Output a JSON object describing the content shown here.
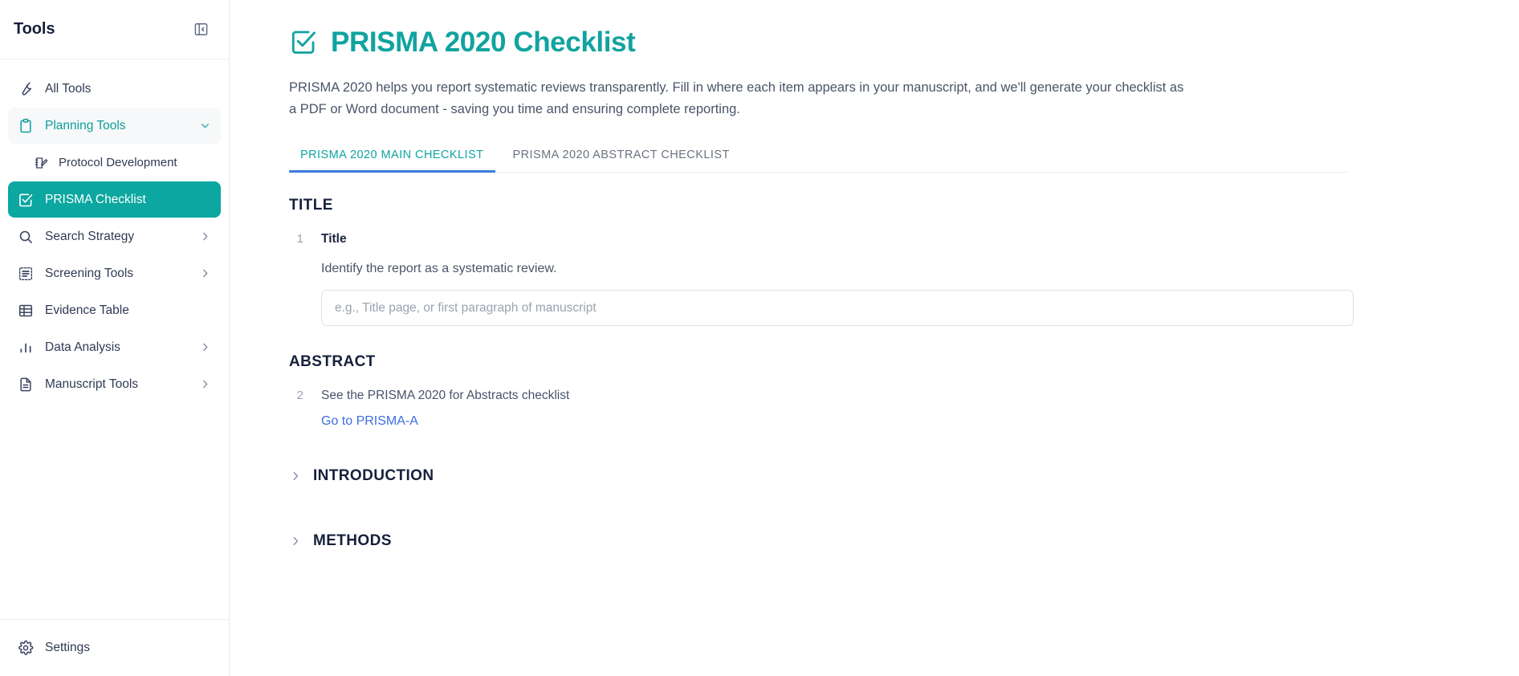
{
  "sidebar": {
    "title": "Tools",
    "collapse_icon": "panel-collapse-left-icon",
    "items": [
      {
        "label": "All Tools",
        "icon": "wrench-icon",
        "state": "default",
        "chevron": ""
      },
      {
        "label": "Planning Tools",
        "icon": "clipboard-icon",
        "state": "expanded",
        "chevron": "chevron-down-icon"
      },
      {
        "label": "Protocol Development",
        "icon": "note-edit-icon",
        "state": "sub",
        "chevron": ""
      },
      {
        "label": "PRISMA Checklist",
        "icon": "checkbox-check-icon",
        "state": "active",
        "chevron": ""
      },
      {
        "label": "Search Strategy",
        "icon": "search-icon",
        "state": "default",
        "chevron": "chevron-right-icon"
      },
      {
        "label": "Screening Tools",
        "icon": "screening-list-icon",
        "state": "default",
        "chevron": "chevron-right-icon"
      },
      {
        "label": "Evidence Table",
        "icon": "table-icon",
        "state": "default",
        "chevron": ""
      },
      {
        "label": "Data Analysis",
        "icon": "bar-chart-icon",
        "state": "default",
        "chevron": "chevron-right-icon"
      },
      {
        "label": "Manuscript Tools",
        "icon": "document-icon",
        "state": "default",
        "chevron": "chevron-right-icon"
      }
    ],
    "footer": {
      "label": "Settings",
      "icon": "gear-icon"
    }
  },
  "main": {
    "title": "PRISMA 2020 Checklist",
    "title_icon": "checkbox-check-icon",
    "intro": "PRISMA 2020 helps you report systematic reviews transparently. Fill in where each item appears in your manuscript, and we'll generate your checklist as a PDF or Word document - saving you time and ensuring complete reporting.",
    "tabs": [
      {
        "label": "PRISMA 2020 MAIN CHECKLIST",
        "active": true
      },
      {
        "label": "PRISMA 2020 ABSTRACT CHECKLIST",
        "active": false
      }
    ],
    "sections": {
      "title": {
        "heading": "TITLE",
        "item_number": "1",
        "item_name": "Title",
        "item_desc": "Identify the report as a systematic review.",
        "input_placeholder": "e.g., Title page, or first paragraph of manuscript",
        "input_value": ""
      },
      "abstract": {
        "heading": "ABSTRACT",
        "item_number": "2",
        "item_name": "See the PRISMA 2020 for Abstracts checklist",
        "link_label": "Go to PRISMA-A"
      }
    },
    "collapsed_sections": [
      {
        "label": "INTRODUCTION",
        "icon": "chevron-right-icon"
      },
      {
        "label": "METHODS",
        "icon": "chevron-right-icon"
      }
    ]
  },
  "colors": {
    "accent_teal": "#0ba7a0",
    "tab_underline_blue": "#3b7ddd",
    "link_blue": "#3b6ee0",
    "heading_dark": "#16203c",
    "body_gray": "#4a5568"
  }
}
